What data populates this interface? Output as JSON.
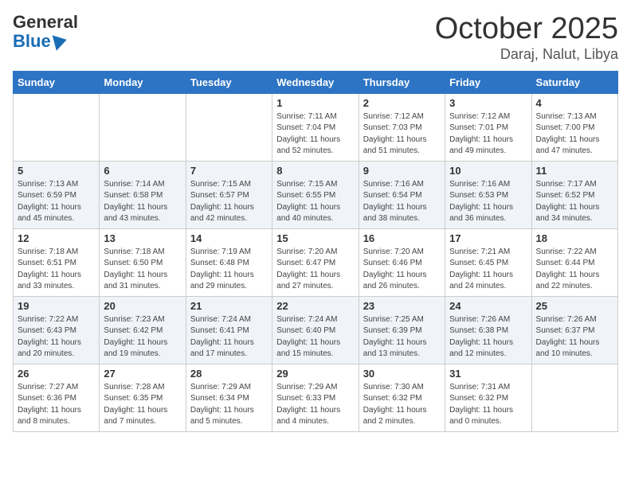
{
  "logo": {
    "general": "General",
    "blue": "Blue"
  },
  "header": {
    "month_year": "October 2025",
    "location": "Daraj, Nalut, Libya"
  },
  "weekdays": [
    "Sunday",
    "Monday",
    "Tuesday",
    "Wednesday",
    "Thursday",
    "Friday",
    "Saturday"
  ],
  "weeks": [
    [
      {
        "day": "",
        "info": ""
      },
      {
        "day": "",
        "info": ""
      },
      {
        "day": "",
        "info": ""
      },
      {
        "day": "1",
        "info": "Sunrise: 7:11 AM\nSunset: 7:04 PM\nDaylight: 11 hours and 52 minutes."
      },
      {
        "day": "2",
        "info": "Sunrise: 7:12 AM\nSunset: 7:03 PM\nDaylight: 11 hours and 51 minutes."
      },
      {
        "day": "3",
        "info": "Sunrise: 7:12 AM\nSunset: 7:01 PM\nDaylight: 11 hours and 49 minutes."
      },
      {
        "day": "4",
        "info": "Sunrise: 7:13 AM\nSunset: 7:00 PM\nDaylight: 11 hours and 47 minutes."
      }
    ],
    [
      {
        "day": "5",
        "info": "Sunrise: 7:13 AM\nSunset: 6:59 PM\nDaylight: 11 hours and 45 minutes."
      },
      {
        "day": "6",
        "info": "Sunrise: 7:14 AM\nSunset: 6:58 PM\nDaylight: 11 hours and 43 minutes."
      },
      {
        "day": "7",
        "info": "Sunrise: 7:15 AM\nSunset: 6:57 PM\nDaylight: 11 hours and 42 minutes."
      },
      {
        "day": "8",
        "info": "Sunrise: 7:15 AM\nSunset: 6:55 PM\nDaylight: 11 hours and 40 minutes."
      },
      {
        "day": "9",
        "info": "Sunrise: 7:16 AM\nSunset: 6:54 PM\nDaylight: 11 hours and 38 minutes."
      },
      {
        "day": "10",
        "info": "Sunrise: 7:16 AM\nSunset: 6:53 PM\nDaylight: 11 hours and 36 minutes."
      },
      {
        "day": "11",
        "info": "Sunrise: 7:17 AM\nSunset: 6:52 PM\nDaylight: 11 hours and 34 minutes."
      }
    ],
    [
      {
        "day": "12",
        "info": "Sunrise: 7:18 AM\nSunset: 6:51 PM\nDaylight: 11 hours and 33 minutes."
      },
      {
        "day": "13",
        "info": "Sunrise: 7:18 AM\nSunset: 6:50 PM\nDaylight: 11 hours and 31 minutes."
      },
      {
        "day": "14",
        "info": "Sunrise: 7:19 AM\nSunset: 6:48 PM\nDaylight: 11 hours and 29 minutes."
      },
      {
        "day": "15",
        "info": "Sunrise: 7:20 AM\nSunset: 6:47 PM\nDaylight: 11 hours and 27 minutes."
      },
      {
        "day": "16",
        "info": "Sunrise: 7:20 AM\nSunset: 6:46 PM\nDaylight: 11 hours and 26 minutes."
      },
      {
        "day": "17",
        "info": "Sunrise: 7:21 AM\nSunset: 6:45 PM\nDaylight: 11 hours and 24 minutes."
      },
      {
        "day": "18",
        "info": "Sunrise: 7:22 AM\nSunset: 6:44 PM\nDaylight: 11 hours and 22 minutes."
      }
    ],
    [
      {
        "day": "19",
        "info": "Sunrise: 7:22 AM\nSunset: 6:43 PM\nDaylight: 11 hours and 20 minutes."
      },
      {
        "day": "20",
        "info": "Sunrise: 7:23 AM\nSunset: 6:42 PM\nDaylight: 11 hours and 19 minutes."
      },
      {
        "day": "21",
        "info": "Sunrise: 7:24 AM\nSunset: 6:41 PM\nDaylight: 11 hours and 17 minutes."
      },
      {
        "day": "22",
        "info": "Sunrise: 7:24 AM\nSunset: 6:40 PM\nDaylight: 11 hours and 15 minutes."
      },
      {
        "day": "23",
        "info": "Sunrise: 7:25 AM\nSunset: 6:39 PM\nDaylight: 11 hours and 13 minutes."
      },
      {
        "day": "24",
        "info": "Sunrise: 7:26 AM\nSunset: 6:38 PM\nDaylight: 11 hours and 12 minutes."
      },
      {
        "day": "25",
        "info": "Sunrise: 7:26 AM\nSunset: 6:37 PM\nDaylight: 11 hours and 10 minutes."
      }
    ],
    [
      {
        "day": "26",
        "info": "Sunrise: 7:27 AM\nSunset: 6:36 PM\nDaylight: 11 hours and 8 minutes."
      },
      {
        "day": "27",
        "info": "Sunrise: 7:28 AM\nSunset: 6:35 PM\nDaylight: 11 hours and 7 minutes."
      },
      {
        "day": "28",
        "info": "Sunrise: 7:29 AM\nSunset: 6:34 PM\nDaylight: 11 hours and 5 minutes."
      },
      {
        "day": "29",
        "info": "Sunrise: 7:29 AM\nSunset: 6:33 PM\nDaylight: 11 hours and 4 minutes."
      },
      {
        "day": "30",
        "info": "Sunrise: 7:30 AM\nSunset: 6:32 PM\nDaylight: 11 hours and 2 minutes."
      },
      {
        "day": "31",
        "info": "Sunrise: 7:31 AM\nSunset: 6:32 PM\nDaylight: 11 hours and 0 minutes."
      },
      {
        "day": "",
        "info": ""
      }
    ]
  ]
}
